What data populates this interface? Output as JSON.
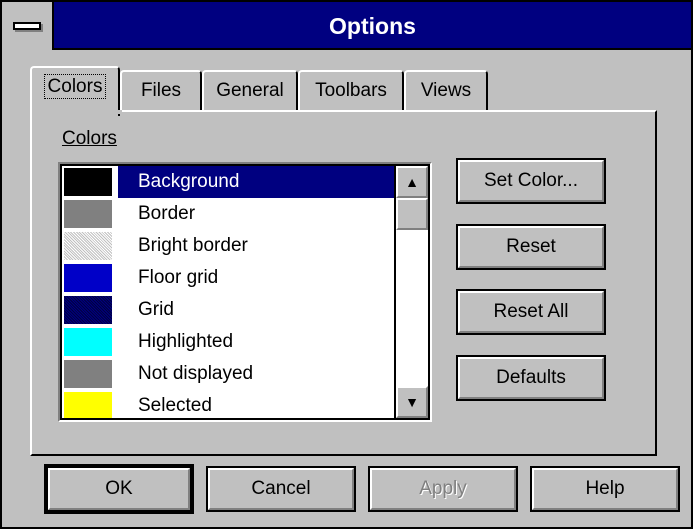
{
  "window": {
    "title": "Options"
  },
  "tabs": [
    {
      "label": "Colors",
      "active": true
    },
    {
      "label": "Files"
    },
    {
      "label": "General"
    },
    {
      "label": "Toolbars"
    },
    {
      "label": "Views"
    }
  ],
  "colors_section": {
    "label": "Colors",
    "items": [
      {
        "name": "Background",
        "color": "#000000",
        "selected": true
      },
      {
        "name": "Border",
        "color": "#808080"
      },
      {
        "name": "Bright border",
        "color": "#c0c0c0"
      },
      {
        "name": "Floor grid",
        "color": "#0000c8"
      },
      {
        "name": "Grid",
        "color": "#000060"
      },
      {
        "name": "Highlighted",
        "color": "#00ffff"
      },
      {
        "name": "Not displayed",
        "color": "#808080"
      },
      {
        "name": "Selected",
        "color": "#ffff00"
      }
    ]
  },
  "side_buttons": {
    "set_color": "Set Color...",
    "reset": "Reset",
    "reset_all": "Reset All",
    "defaults": "Defaults"
  },
  "bottom_buttons": {
    "ok": "OK",
    "cancel": "Cancel",
    "apply": "Apply",
    "help": "Help"
  },
  "icons": {
    "system_menu": "system-menu-icon",
    "scroll_up": "up-arrow-icon",
    "scroll_down": "down-arrow-icon"
  }
}
